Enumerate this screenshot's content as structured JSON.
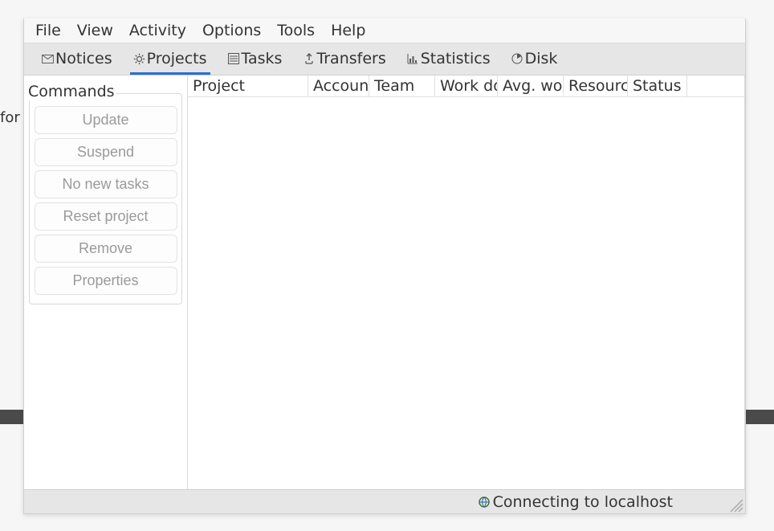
{
  "bg_text_left": "for o",
  "menubar": {
    "items": [
      "File",
      "View",
      "Activity",
      "Options",
      "Tools",
      "Help"
    ]
  },
  "tabs": [
    {
      "label": "Notices",
      "active": false,
      "icon": "mail-icon"
    },
    {
      "label": "Projects",
      "active": true,
      "icon": "gear-icon"
    },
    {
      "label": "Tasks",
      "active": false,
      "icon": "list-icon"
    },
    {
      "label": "Transfers",
      "active": false,
      "icon": "transfer-icon"
    },
    {
      "label": "Statistics",
      "active": false,
      "icon": "barchart-icon"
    },
    {
      "label": "Disk",
      "active": false,
      "icon": "disk-icon"
    }
  ],
  "commands": {
    "title": "Commands",
    "buttons": [
      "Update",
      "Suspend",
      "No new tasks",
      "Reset project",
      "Remove",
      "Properties"
    ]
  },
  "table": {
    "columns": [
      "Project",
      "Account",
      "Team",
      "Work do",
      "Avg. wor",
      "Resource",
      "Status"
    ],
    "rows": []
  },
  "statusbar": {
    "text": "Connecting to localhost"
  }
}
